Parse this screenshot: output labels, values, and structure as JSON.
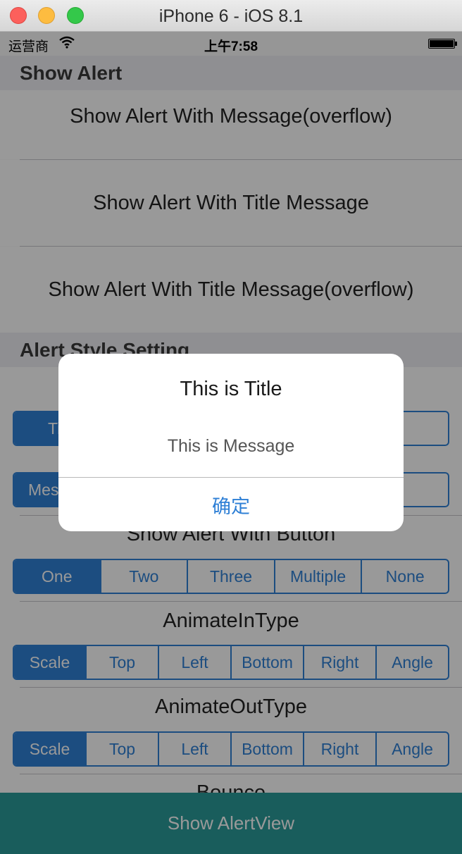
{
  "window": {
    "title": "iPhone 6 - iOS 8.1"
  },
  "statusbar": {
    "carrier": "运营商",
    "time": "上午7:58"
  },
  "sections": {
    "show_alert": "Show Alert",
    "style_setting": "Alert Style Setting"
  },
  "cells": [
    "Show Alert With Message(overflow)",
    "Show Alert With Title Message",
    "Show Alert With Title Message(overflow)"
  ],
  "seg_title": {
    "first": "Ti"
  },
  "seg_message": {
    "first": "Mes"
  },
  "button_label": "Show Alert With Button",
  "button_options": [
    "One",
    "Two",
    "Three",
    "Multiple",
    "None"
  ],
  "animate_in_label": "AnimateInType",
  "animate_in_options": [
    "Scale",
    "Top",
    "Left",
    "Bottom",
    "Right",
    "Angle"
  ],
  "animate_out_label": "AnimateOutType",
  "animate_out_options": [
    "Scale",
    "Top",
    "Left",
    "Bottom",
    "Right",
    "Angle"
  ],
  "bounce_label": "Bounce",
  "bottom_button": "Show AlertView",
  "alert": {
    "title": "This is Title",
    "message": "This is Message",
    "button": "确定"
  },
  "colors": {
    "accent": "#2f80d6",
    "bottom_button": "#2a9b9a"
  }
}
